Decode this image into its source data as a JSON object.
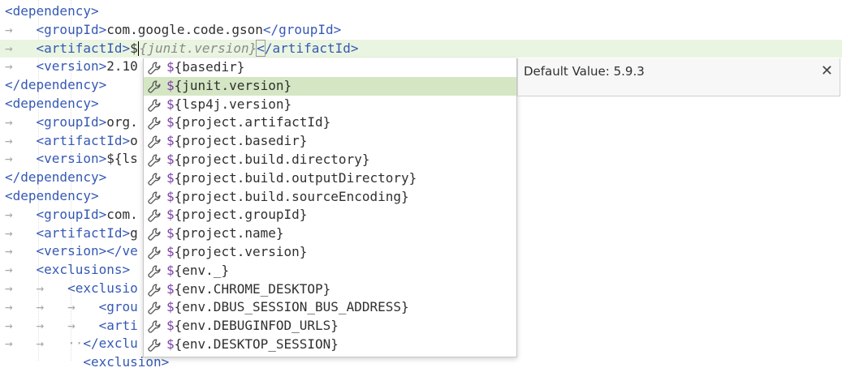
{
  "editor": {
    "lines": [
      {
        "indent": "",
        "parts": [
          [
            "tag",
            "<dependency>"
          ]
        ]
      },
      {
        "indent": "→   ",
        "parts": [
          [
            "tag",
            "<groupId>"
          ],
          [
            "txt",
            "com.google.code.gson"
          ],
          [
            "tag",
            "</groupId>"
          ]
        ]
      },
      {
        "indent": "→   ",
        "current": true,
        "parts": [
          [
            "tag",
            "<artifactId>"
          ],
          [
            "txt",
            "$"
          ],
          [
            "caret",
            ""
          ],
          [
            "hint",
            "{junit.version}"
          ],
          [
            "tagbox",
            "<"
          ],
          [
            "tag",
            "/artifactId>"
          ]
        ]
      },
      {
        "indent": "→   ",
        "parts": [
          [
            "tag",
            "<version>"
          ],
          [
            "txt",
            "2.10"
          ]
        ]
      },
      {
        "indent": "",
        "parts": [
          [
            "tag",
            "</dependency>"
          ]
        ]
      },
      {
        "indent": "",
        "parts": [
          [
            "tag",
            "<dependency>"
          ]
        ]
      },
      {
        "indent": "→   ",
        "parts": [
          [
            "tag",
            "<groupId>"
          ],
          [
            "txt",
            "org."
          ]
        ]
      },
      {
        "indent": "→   ",
        "parts": [
          [
            "tag",
            "<artifactId>"
          ],
          [
            "txt",
            "o"
          ]
        ]
      },
      {
        "indent": "→   ",
        "parts": [
          [
            "tag",
            "<version>"
          ],
          [
            "txt",
            "${ls"
          ]
        ]
      },
      {
        "indent": "",
        "parts": [
          [
            "tag",
            "</dependency>"
          ]
        ]
      },
      {
        "indent": "",
        "parts": [
          [
            "tag",
            "<dependency>"
          ]
        ]
      },
      {
        "indent": "→   ",
        "parts": [
          [
            "tag",
            "<groupId>"
          ],
          [
            "txt",
            "com."
          ]
        ]
      },
      {
        "indent": "→   ",
        "parts": [
          [
            "tag",
            "<artifactId>"
          ],
          [
            "txt",
            "g"
          ]
        ]
      },
      {
        "indent": "→   ",
        "parts": [
          [
            "tag",
            "<version></ve"
          ]
        ]
      },
      {
        "indent": "→   ",
        "parts": [
          [
            "tag",
            "<exclusions>"
          ]
        ]
      },
      {
        "indent": "→   →   ",
        "parts": [
          [
            "tag",
            "<exclusio"
          ]
        ]
      },
      {
        "indent": "→   →   →   ",
        "parts": [
          [
            "tag",
            "<grou"
          ]
        ]
      },
      {
        "indent": "→   →   →   ",
        "parts": [
          [
            "tag",
            "<arti"
          ]
        ]
      },
      {
        "indent": "→   →   ··",
        "parts": [
          [
            "tag",
            "</exclu"
          ]
        ]
      },
      {
        "indent": "          ",
        "parts": [
          [
            "tag",
            "<exclusion>"
          ]
        ]
      }
    ]
  },
  "completion": {
    "items": [
      "{basedir}",
      "{junit.version}",
      "{lsp4j.version}",
      "{project.artifactId}",
      "{project.basedir}",
      "{project.build.directory}",
      "{project.build.outputDirectory}",
      "{project.build.sourceEncoding}",
      "{project.groupId}",
      "{project.name}",
      "{project.version}",
      "{env._}",
      "{env.CHROME_DESKTOP}",
      "{env.DBUS_SESSION_BUS_ADDRESS}",
      "{env.DEBUGINFOD_URLS}",
      "{env.DESKTOP_SESSION}"
    ],
    "prefix": "$",
    "selected_index": 1,
    "icon": "wrench-icon"
  },
  "doc_popup": {
    "text": "Default Value: 5.9.3",
    "close_label": "✕"
  },
  "colors": {
    "tag": "#3559b5",
    "current_line": "#eaf5e1",
    "selected_item": "#d5e6c4",
    "dollar": "#7b3fa8"
  }
}
